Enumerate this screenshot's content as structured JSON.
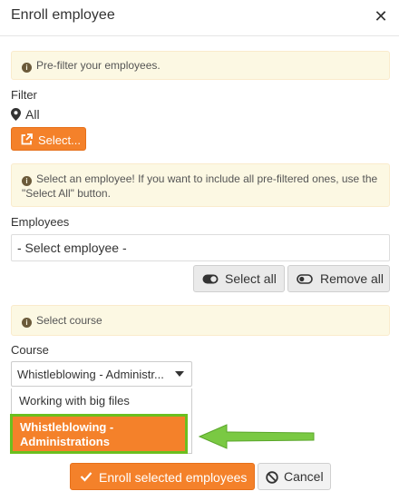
{
  "dialog": {
    "title": "Enroll employee",
    "close_icon": "close-icon"
  },
  "filter_section": {
    "notice": "Pre-filter your employees.",
    "label": "Filter",
    "value": "All",
    "select_button": "Select..."
  },
  "employees_section": {
    "notice": "Select an employee! If you want to include all pre-filtered ones, use the \"Select All\" button.",
    "label": "Employees",
    "input_value": "- Select employee -",
    "select_all_button": "Select all",
    "remove_all_button": "Remove all"
  },
  "course_section": {
    "notice": "Select course",
    "label": "Course",
    "selected_value": "Whistleblowing - Administr...",
    "options": [
      "Working with big files",
      "Whistleblowing - Administrations"
    ]
  },
  "footer": {
    "enroll_button": "Enroll selected employees",
    "cancel_button": "Cancel"
  },
  "colors": {
    "accent": "#f4812a",
    "notice_bg": "#fcf8e3",
    "highlight": "#6bbf1f"
  }
}
